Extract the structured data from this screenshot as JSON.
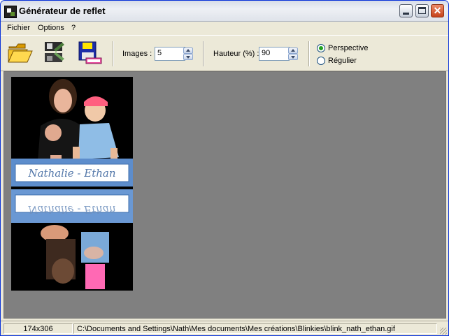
{
  "window": {
    "title": "Générateur de reflet"
  },
  "menu": {
    "items": [
      "Fichier",
      "Options",
      "?"
    ]
  },
  "toolbar": {
    "images_label": "Images :",
    "images_value": "5",
    "height_label": "Hauteur (%) :",
    "height_value": "90",
    "options": [
      {
        "label": "Perspective",
        "checked": true
      },
      {
        "label": "Régulier",
        "checked": false
      }
    ]
  },
  "preview": {
    "banner_text": "Nathalie - Ethan"
  },
  "status": {
    "dimensions": "174x306",
    "path": "C:\\Documents and Settings\\Nath\\Mes documents\\Mes créations\\Blinkies\\blink_nath_ethan.gif"
  }
}
